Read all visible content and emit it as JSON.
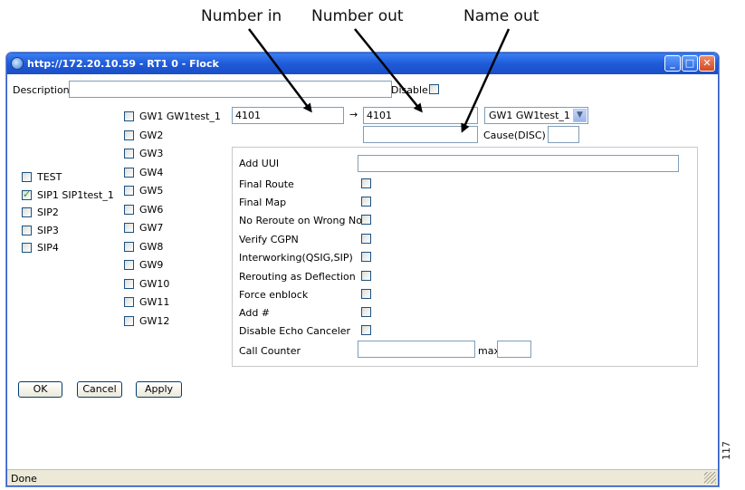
{
  "callouts": {
    "number_in": "Number in",
    "number_out": "Number out",
    "name_out": "Name out"
  },
  "figure_number": "117",
  "window": {
    "title": "http://172.20.10.59 - RT1 0  - Flock",
    "buttons": {
      "minimize": "_",
      "maximize": "□",
      "close": "✕"
    }
  },
  "form": {
    "description_label": "Description",
    "description_value": "",
    "disable_label": "Disable",
    "disable_checked": false,
    "number_in_value": "4101",
    "arrow": "→",
    "number_out_value": "4101",
    "gw_select_value": "GW1  GW1test_1",
    "name_out_value": "",
    "cause_label": "Cause(DISC)",
    "cause_value": "",
    "left_items": [
      {
        "label": "TEST",
        "checked": false
      },
      {
        "label": "SIP1 SIP1test_1",
        "checked": true
      },
      {
        "label": "SIP2",
        "checked": false
      },
      {
        "label": "SIP3",
        "checked": false
      },
      {
        "label": "SIP4",
        "checked": false
      }
    ],
    "gw_items": [
      {
        "label": "GW1 GW1test_1",
        "checked": false
      },
      {
        "label": "GW2",
        "checked": false
      },
      {
        "label": "GW3",
        "checked": false
      },
      {
        "label": "GW4",
        "checked": false
      },
      {
        "label": "GW5",
        "checked": false
      },
      {
        "label": "GW6",
        "checked": false
      },
      {
        "label": "GW7",
        "checked": false
      },
      {
        "label": "GW8",
        "checked": false
      },
      {
        "label": "GW9",
        "checked": false
      },
      {
        "label": "GW10",
        "checked": false
      },
      {
        "label": "GW11",
        "checked": false
      },
      {
        "label": "GW12",
        "checked": false
      }
    ],
    "options": {
      "add_uui": "Add UUI",
      "add_uui_value": "",
      "final_route": "Final Route",
      "final_map": "Final Map",
      "no_reroute": "No Reroute on Wrong No",
      "verify_cgpn": "Verify CGPN",
      "interworking": "Interworking(QSIG,SIP)",
      "rerouting": "Rerouting as Deflection",
      "force_enblock": "Force enblock",
      "add_hash": "Add #",
      "disable_echo": "Disable Echo Canceler",
      "call_counter": "Call Counter",
      "call_counter_value": "",
      "max_label": "max",
      "max_value": ""
    },
    "buttons": {
      "ok": "OK",
      "cancel": "Cancel",
      "apply": "Apply"
    }
  },
  "status": {
    "text": "Done"
  }
}
